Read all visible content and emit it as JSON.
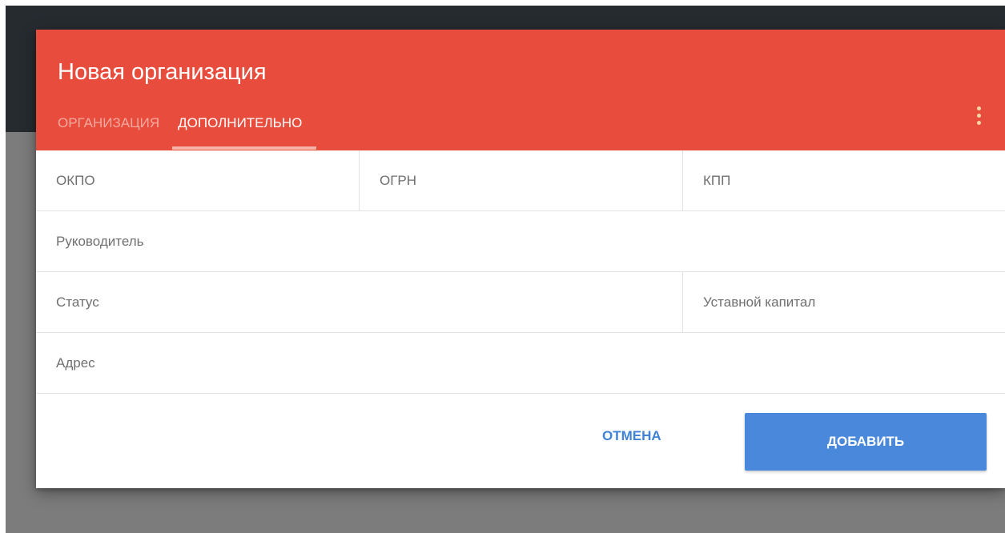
{
  "dialog": {
    "title": "Новая организация",
    "tabs": [
      {
        "label": "ОРГАНИЗАЦИЯ",
        "active": false
      },
      {
        "label": "ДОПОЛНИТЕЛЬНО",
        "active": true
      }
    ],
    "menu_icon": "more-vert-icon",
    "header_color": "#e74c3c"
  },
  "form": {
    "rows": [
      [
        {
          "label": "ОКПО"
        },
        {
          "label": "ОГРН"
        },
        {
          "label": "КПП"
        }
      ],
      [
        {
          "label": "Руководитель"
        }
      ],
      [
        {
          "label": "Статус"
        },
        {
          "label": "Уставной капитал"
        }
      ],
      [
        {
          "label": "Адрес"
        }
      ]
    ]
  },
  "actions": {
    "cancel_label": "ОТМЕНА",
    "add_label": "ДОБАВИТЬ",
    "primary_color": "#4a88db"
  }
}
